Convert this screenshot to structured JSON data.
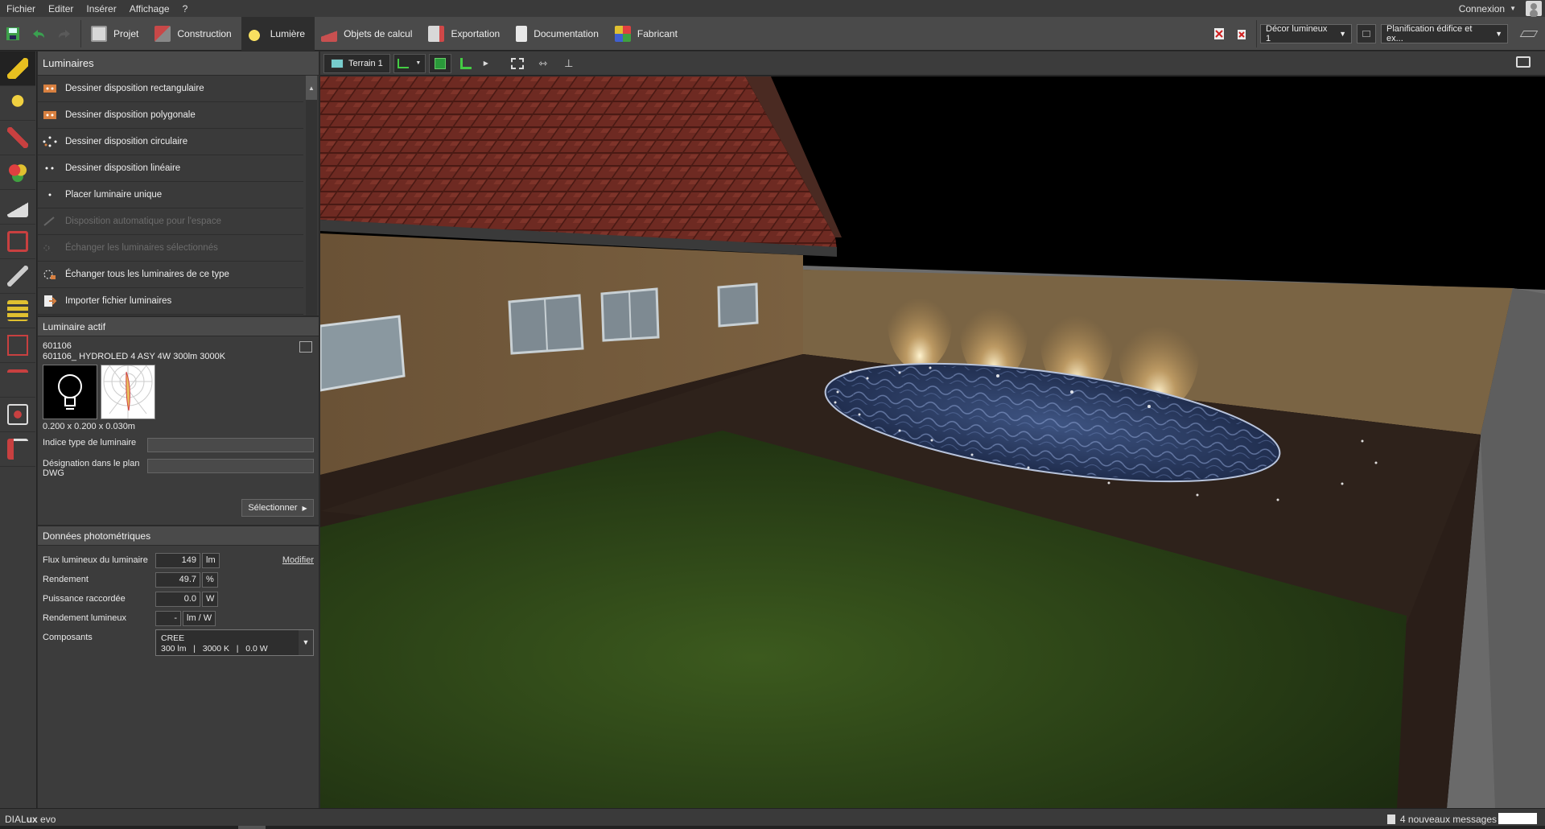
{
  "menu": [
    "Fichier",
    "Editer",
    "Insérer",
    "Affichage",
    "?"
  ],
  "login": "Connexion",
  "ribbon": {
    "tabs": [
      {
        "label": "Projet",
        "icon": "project-icon",
        "color": "#d8d8d8"
      },
      {
        "label": "Construction",
        "icon": "construction-icon",
        "color": "#c84848"
      },
      {
        "label": "Lumière",
        "icon": "light-icon",
        "color": "#e8c020"
      },
      {
        "label": "Objets de calcul",
        "icon": "calculation-icon",
        "color": "#c85050"
      },
      {
        "label": "Exportation",
        "icon": "export-icon",
        "color": "#d06060"
      },
      {
        "label": "Documentation",
        "icon": "documentation-icon",
        "color": "#e0e0e0"
      },
      {
        "label": "Fabricant",
        "icon": "manufacturer-icon",
        "color": "#c8a040"
      }
    ],
    "active_tab": "Lumière",
    "light_scene": "Décor lumineux 1",
    "planning": "Planification édifice et ex..."
  },
  "luminaires": {
    "title": "Luminaires",
    "items": [
      {
        "label": "Dessiner disposition rectangulaire",
        "icon": "rectangular-layout-icon",
        "enabled": true
      },
      {
        "label": "Dessiner disposition polygonale",
        "icon": "polygonal-layout-icon",
        "enabled": true
      },
      {
        "label": "Dessiner disposition circulaire",
        "icon": "circular-layout-icon",
        "enabled": true
      },
      {
        "label": "Dessiner disposition linéaire",
        "icon": "linear-layout-icon",
        "enabled": true
      },
      {
        "label": "Placer luminaire unique",
        "icon": "single-luminaire-icon",
        "enabled": true
      },
      {
        "label": "Disposition automatique pour l'espace",
        "icon": "auto-layout-icon",
        "enabled": false
      },
      {
        "label": "Échanger les luminaires sélectionnés",
        "icon": "swap-selected-icon",
        "enabled": false
      },
      {
        "label": "Échanger tous les luminaires de ce type",
        "icon": "swap-all-icon",
        "enabled": true
      },
      {
        "label": "Importer fichier luminaires",
        "icon": "import-file-icon",
        "enabled": true
      }
    ]
  },
  "active_luminaire": {
    "title": "Luminaire actif",
    "code": "601106",
    "name": "601106_ HYDROLED 4 ASY 4W 300lm 3000K",
    "dimensions": "0.200 x 0.200 x 0.030m",
    "type_index_label": "Indice type de luminaire",
    "dwg_label": "Désignation dans le plan DWG",
    "select_label": "Sélectionner"
  },
  "photometric": {
    "title": "Données photométriques",
    "modify_label": "Modifier",
    "rows": [
      {
        "label": "Flux lumineux du luminaire",
        "value": "149",
        "unit": "lm"
      },
      {
        "label": "Rendement",
        "value": "49.7",
        "unit": "%"
      },
      {
        "label": "Puissance raccordée",
        "value": "0.0",
        "unit": "W"
      },
      {
        "label": "Rendement lumineux",
        "value": "-",
        "unit": "lm / W"
      }
    ],
    "components_label": "Composants",
    "components": {
      "maker": "CREE",
      "detail": "300 lm   |   3000 K   |   0.0 W"
    }
  },
  "viewport": {
    "terrain_label": "Terrain 1"
  },
  "status": {
    "brand_a": "DIAL",
    "brand_b": "ux",
    "brand_c": " evo",
    "messages": "4 nouveaux messages"
  }
}
